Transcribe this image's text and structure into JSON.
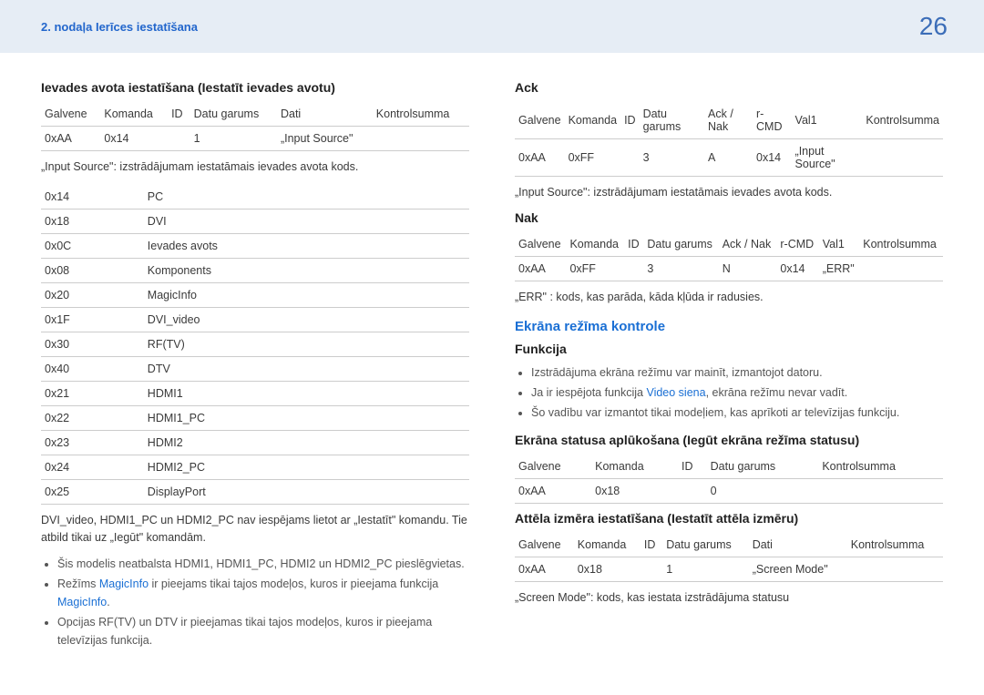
{
  "header": {
    "chapter": "2. nodaļa Ierīces iestatīšana",
    "page": "26"
  },
  "left": {
    "h1": "Ievades avota iestatīšana (Iestatīt ievades avotu)",
    "t1": {
      "headers": [
        "Galvene",
        "Komanda",
        "ID",
        "Datu garums",
        "Dati",
        "Kontrolsumma"
      ],
      "row": [
        "0xAA",
        "0x14",
        "",
        "1",
        "„Input Source\"",
        ""
      ]
    },
    "note1": "„Input Source\": izstrādājumam iestatāmais ievades avota kods.",
    "codes": [
      [
        "0x14",
        "PC"
      ],
      [
        "0x18",
        "DVI"
      ],
      [
        "0x0C",
        "Ievades avots"
      ],
      [
        "0x08",
        "Komponents"
      ],
      [
        "0x20",
        "MagicInfo"
      ],
      [
        "0x1F",
        "DVI_video"
      ],
      [
        "0x30",
        "RF(TV)"
      ],
      [
        "0x40",
        "DTV"
      ],
      [
        "0x21",
        "HDMI1"
      ],
      [
        "0x22",
        "HDMI1_PC"
      ],
      [
        "0x23",
        "HDMI2"
      ],
      [
        "0x24",
        "HDMI2_PC"
      ],
      [
        "0x25",
        "DisplayPort"
      ]
    ],
    "note2": "DVI_video, HDMI1_PC un HDMI2_PC nav iespējams lietot ar „Iestatīt\" komandu. Tie atbild tikai uz „Iegūt\" komandām.",
    "bullets": [
      {
        "pre": "Šis modelis neatbalsta HDMI1, HDMI1_PC, HDMI2 un HDMI2_PC pieslēgvietas.",
        "links": []
      },
      {
        "pre": "Režīms ",
        "link1": "MagicInfo",
        "mid": " ir pieejams tikai tajos modeļos, kuros ir pieejama funkcija ",
        "link2": "MagicInfo",
        "post": "."
      },
      {
        "pre": "Opcijas RF(TV) un DTV ir pieejamas tikai tajos modeļos, kuros ir pieejama televīzijas funkcija.",
        "links": []
      }
    ]
  },
  "right": {
    "ack_h": "Ack",
    "ack_t": {
      "headers": [
        "Galvene",
        "Komanda",
        "ID",
        "Datu garums",
        "Ack / Nak",
        "r-CMD",
        "Val1",
        "Kontrolsumma"
      ],
      "row": [
        "0xAA",
        "0xFF",
        "",
        "3",
        "A",
        "0x14",
        "„Input Source\"",
        ""
      ]
    },
    "note_ack": "„Input Source\": izstrādājumam iestatāmais ievades avota kods.",
    "nak_h": "Nak",
    "nak_t": {
      "headers": [
        "Galvene",
        "Komanda",
        "ID",
        "Datu garums",
        "Ack / Nak",
        "r-CMD",
        "Val1",
        "Kontrolsumma"
      ],
      "row": [
        "0xAA",
        "0xFF",
        "",
        "3",
        "N",
        "0x14",
        "„ERR\"",
        ""
      ]
    },
    "note_nak": "„ERR\" : kods, kas parāda, kāda kļūda ir radusies.",
    "sec2_h": "Ekrāna režīma kontrole",
    "func_h": "Funkcija",
    "func_bullets": [
      {
        "text": "Izstrādājuma ekrāna režīmu var mainīt, izmantojot datoru."
      },
      {
        "pre": "Ja ir iespējota funkcija ",
        "link": "Video siena",
        "post": ", ekrāna režīmu nevar vadīt."
      },
      {
        "text": "Šo vadību var izmantot tikai modeļiem, kas aprīkoti ar televīzijas funkciju."
      }
    ],
    "h2": "Ekrāna statusa aplūkošana (Iegūt ekrāna režīma statusu)",
    "t2": {
      "headers": [
        "Galvene",
        "Komanda",
        "ID",
        "Datu garums",
        "Kontrolsumma"
      ],
      "row": [
        "0xAA",
        "0x18",
        "",
        "0",
        ""
      ]
    },
    "h3": "Attēla izmēra iestatīšana (Iestatīt attēla izmēru)",
    "t3": {
      "headers": [
        "Galvene",
        "Komanda",
        "ID",
        "Datu garums",
        "Dati",
        "Kontrolsumma"
      ],
      "row": [
        "0xAA",
        "0x18",
        "",
        "1",
        "„Screen Mode\"",
        ""
      ]
    },
    "note_sm": "„Screen Mode\": kods, kas iestata izstrādājuma statusu"
  }
}
